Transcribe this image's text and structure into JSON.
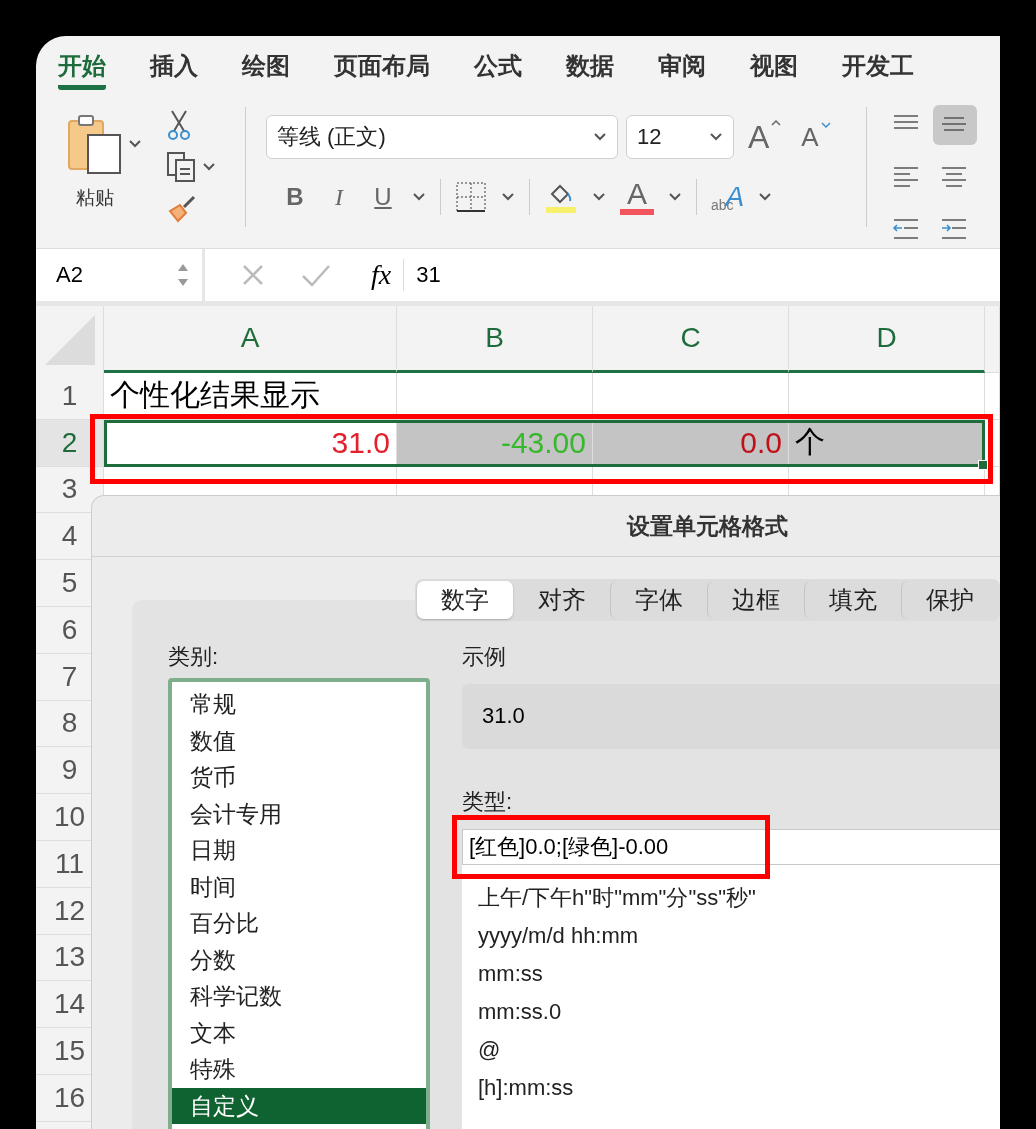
{
  "ribbon": {
    "tabs": [
      {
        "label": "开始",
        "selected": true
      },
      {
        "label": "插入",
        "selected": false
      },
      {
        "label": "绘图",
        "selected": false
      },
      {
        "label": "页面布局",
        "selected": false
      },
      {
        "label": "公式",
        "selected": false
      },
      {
        "label": "数据",
        "selected": false
      },
      {
        "label": "审阅",
        "selected": false
      },
      {
        "label": "视图",
        "selected": false
      },
      {
        "label": "开发工",
        "selected": false
      }
    ]
  },
  "clipboard": {
    "paste_label": "粘贴"
  },
  "font": {
    "name": "等线 (正文)",
    "size": "12",
    "grow_glyph": "A",
    "shrink_glyph": "A",
    "styles": [
      {
        "glyph": "B",
        "kind": "bold"
      },
      {
        "glyph": "I",
        "kind": "italic"
      },
      {
        "glyph": "U",
        "kind": "underline"
      }
    ],
    "font_color_glyph": "A",
    "text_effect_small": "abc",
    "text_effect_large": "A"
  },
  "alignment": [
    {
      "kind": "top",
      "selected": false
    },
    {
      "kind": "middle",
      "selected": true
    },
    {
      "kind": "left",
      "selected": false
    },
    {
      "kind": "center",
      "selected": false
    },
    {
      "kind": "outdent",
      "selected": false
    },
    {
      "kind": "indent",
      "selected": false
    }
  ],
  "formula_bar": {
    "name_box": "A2",
    "fx": "fx",
    "formula": "31"
  },
  "sheet": {
    "columns": [
      {
        "label": "A",
        "selected": true
      },
      {
        "label": "B",
        "selected": true
      },
      {
        "label": "C",
        "selected": true
      },
      {
        "label": "D",
        "selected": true
      }
    ],
    "rows": [
      {
        "label": "1",
        "selected": false,
        "cells": [
          {
            "text": "个性化结果显示",
            "filled": false
          }
        ]
      },
      {
        "label": "2",
        "selected": true,
        "cells": [
          {
            "text": "31.0",
            "color": "#e3202b",
            "filled": false,
            "kind": "number"
          },
          {
            "text": "-43.00",
            "color": "#36b82b",
            "filled": true,
            "kind": "number"
          },
          {
            "text": "0.0",
            "color": "#c0111a",
            "filled": true,
            "kind": "number"
          },
          {
            "text": "个",
            "color": "#000000",
            "filled": true,
            "kind": "text"
          }
        ]
      },
      {
        "label": "3",
        "selected": false
      },
      {
        "label": "4",
        "selected": false
      },
      {
        "label": "5",
        "selected": false
      },
      {
        "label": "6",
        "selected": false
      },
      {
        "label": "7",
        "selected": false
      },
      {
        "label": "8",
        "selected": false
      },
      {
        "label": "9",
        "selected": false
      },
      {
        "label": "10",
        "selected": false
      },
      {
        "label": "11",
        "selected": false
      },
      {
        "label": "12",
        "selected": false
      },
      {
        "label": "13",
        "selected": false
      },
      {
        "label": "14",
        "selected": false
      },
      {
        "label": "15",
        "selected": false
      },
      {
        "label": "16",
        "selected": false
      }
    ]
  },
  "dialog": {
    "title": "设置单元格格式",
    "tabs": [
      {
        "label": "数字",
        "selected": true
      },
      {
        "label": "对齐",
        "selected": false
      },
      {
        "label": "字体",
        "selected": false
      },
      {
        "label": "边框",
        "selected": false
      },
      {
        "label": "填充",
        "selected": false
      },
      {
        "label": "保护",
        "selected": false
      }
    ],
    "category_label": "类别:",
    "categories": [
      {
        "label": "常规",
        "selected": false
      },
      {
        "label": "数值",
        "selected": false
      },
      {
        "label": "货币",
        "selected": false
      },
      {
        "label": "会计专用",
        "selected": false
      },
      {
        "label": "日期",
        "selected": false
      },
      {
        "label": "时间",
        "selected": false
      },
      {
        "label": "百分比",
        "selected": false
      },
      {
        "label": "分数",
        "selected": false
      },
      {
        "label": "科学记数",
        "selected": false
      },
      {
        "label": "文本",
        "selected": false
      },
      {
        "label": "特殊",
        "selected": false
      },
      {
        "label": "自定义",
        "selected": true
      }
    ],
    "sample_label": "示例",
    "sample": "31.0",
    "type_label": "类型:",
    "type_value": "[红色]0.0;[绿色]-0.00",
    "formats": [
      "上午/下午h\"时\"mm\"分\"ss\"秒\"",
      "yyyy/m/d hh:mm",
      "mm:ss",
      "mm:ss.0",
      "@",
      "[h]:mm:ss"
    ]
  }
}
